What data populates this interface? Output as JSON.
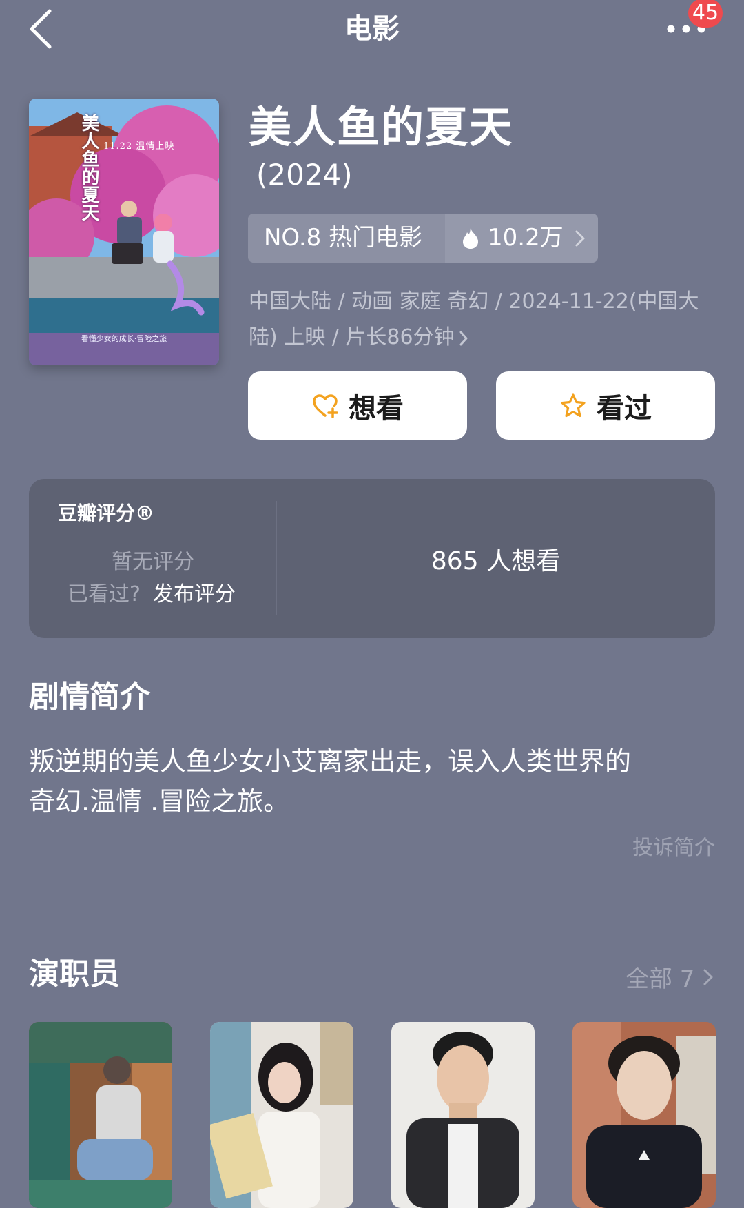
{
  "header": {
    "title": "电影",
    "notification_count": "45"
  },
  "movie": {
    "title": "美人鱼的夏天",
    "year": "(2024)",
    "poster": {
      "title_text": "美人鱼的夏天",
      "release_text": "11.22 温情上映",
      "tagline": "看懂少女的成长·冒险之旅"
    },
    "rank_label": "NO.8 热门电影",
    "heat_value": "10.2万",
    "meta_line1": "中国大陆 / 动画 家庭 奇幻 / 2024-11-22(中国大",
    "meta_line2": "陆) 上映 / 片长86分钟"
  },
  "actions": {
    "want_label": "想看",
    "seen_label": "看过"
  },
  "rating": {
    "label": "豆瓣评分®",
    "no_rating": "暂无评分",
    "seen_question": "已看过?",
    "publish_label": "发布评分",
    "want_count": "865 人想看"
  },
  "synopsis": {
    "title": "剧情简介",
    "text_line1": "叛逆期的美人鱼少女小艾离家出走，误入人类世界的",
    "text_line2": "奇幻.温情 .冒险之旅。",
    "report_label": "投诉简介"
  },
  "cast": {
    "title": "演职员",
    "all_label": "全部 7"
  },
  "colors": {
    "background": "#71768c",
    "card": "#5e6273",
    "accent_orange": "#f3a21f",
    "badge_red": "#ef4a4e"
  }
}
